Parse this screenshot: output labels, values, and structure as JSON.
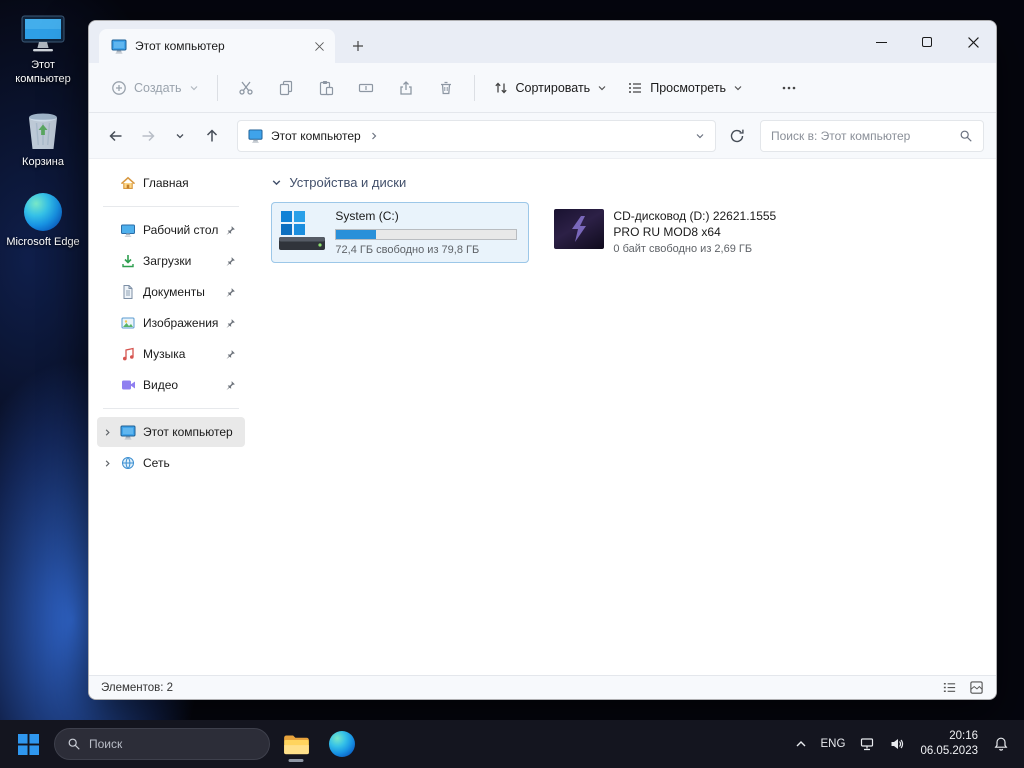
{
  "desktop": {
    "icons": [
      {
        "label": "Этот компьютер"
      },
      {
        "label": "Корзина"
      },
      {
        "label": "Microsoft Edge"
      }
    ]
  },
  "explorer": {
    "tab": {
      "title": "Этот компьютер"
    },
    "toolbar": {
      "new": "Создать",
      "sort": "Сортировать",
      "view": "Просмотреть"
    },
    "navbar": {
      "breadcrumb": "Этот компьютер",
      "search_placeholder": "Поиск в: Этот компьютер"
    },
    "sidebar": {
      "items": [
        {
          "label": "Главная",
          "pinned": false
        },
        {
          "label": "Рабочий стол",
          "pinned": true
        },
        {
          "label": "Загрузки",
          "pinned": true
        },
        {
          "label": "Документы",
          "pinned": true
        },
        {
          "label": "Изображения",
          "pinned": true
        },
        {
          "label": "Музыка",
          "pinned": true
        },
        {
          "label": "Видео",
          "pinned": true
        },
        {
          "label": "Этот компьютер",
          "pinned": false,
          "selected": true
        },
        {
          "label": "Сеть",
          "pinned": false
        }
      ]
    },
    "content": {
      "group_title": "Устройства и диски",
      "drives": [
        {
          "name": "System (C:)",
          "free_text": "72,4 ГБ свободно из 79,8 ГБ",
          "usage_percent": 22
        },
        {
          "name": "CD-дисковод (D:) 22621.1555 PRO RU MOD8 x64",
          "free_text": "0 байт свободно из 2,69 ГБ"
        }
      ]
    },
    "statusbar": {
      "items_count": "Элементов: 2"
    }
  },
  "taskbar": {
    "search_placeholder": "Поиск",
    "tray": {
      "language": "ENG",
      "time": "20:16",
      "date": "06.05.2023"
    }
  },
  "colors": {
    "accent": "#0078d4",
    "usage_bar": "#2990d9",
    "selection_bg": "#e9f3fb",
    "selection_border": "#9cc7e8"
  }
}
